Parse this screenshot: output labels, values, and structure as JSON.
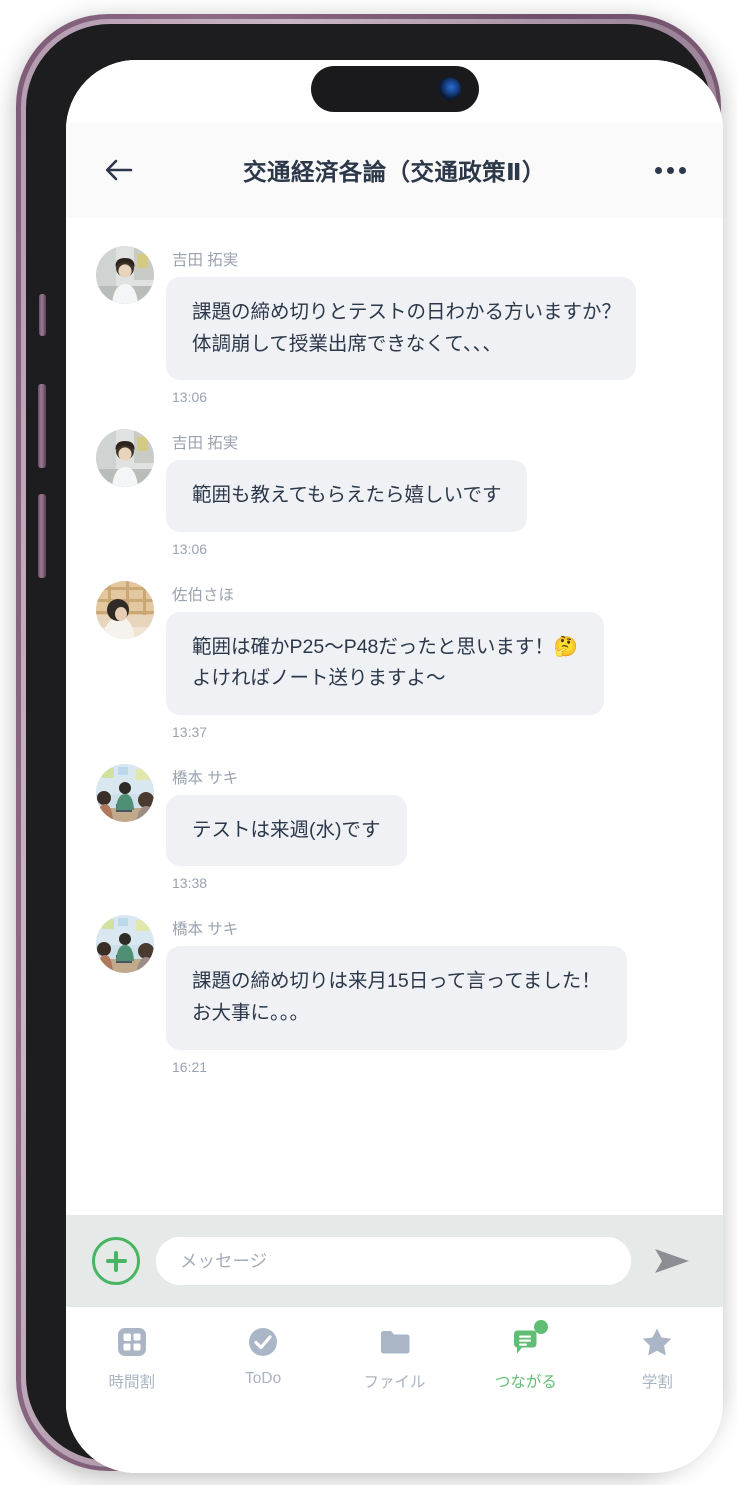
{
  "device": {
    "frame_color": "#7e5c78",
    "bezel_color": "#1d1d1f",
    "island_label": "dynamic-island"
  },
  "appbar": {
    "title": "交通経済各論（交通政策Ⅱ）",
    "back_icon": "arrow-left-icon",
    "more_icon": "more-options-icon",
    "background": "#fafafa",
    "text_color": "#2c3849"
  },
  "chat": {
    "bubble_color": "#eff1f5",
    "text_color": "#2c3849",
    "meta_color": "#9aa3af",
    "messages": [
      {
        "sender": "吉田 拓実",
        "avatar": "avatar-yoshida",
        "lines": [
          "課題の締め切りとテストの日わかる方いますか？",
          "体調崩して授業出席できなくて、、、"
        ],
        "time": "13:06"
      },
      {
        "sender": "吉田 拓実",
        "avatar": "avatar-yoshida",
        "lines": [
          "範囲も教えてもらえたら嬉しいです"
        ],
        "time": "13:06"
      },
      {
        "sender": "佐伯さほ",
        "avatar": "avatar-saeki",
        "lines": [
          "範囲は確かP25〜P48だったと思います！🤔",
          "よければノート送りますよ〜"
        ],
        "time": "13:37"
      },
      {
        "sender": "橋本 サキ",
        "avatar": "avatar-hashimoto",
        "lines": [
          "テストは来週(水)です"
        ],
        "time": "13:38"
      },
      {
        "sender": "橋本 サキ",
        "avatar": "avatar-hashimoto",
        "lines": [
          "課題の締め切りは来月15日って言ってました！",
          "お大事に。。。"
        ],
        "time": "16:21"
      }
    ]
  },
  "composer": {
    "add_icon": "plus-circle-icon",
    "placeholder": "メッセージ",
    "value": "",
    "send_icon": "send-arrow-icon",
    "background": "#e5eae9",
    "accent": "#49b563"
  },
  "bottomnav": {
    "active_color": "#5fbe73",
    "inactive_color": "#a9b4c4",
    "items": [
      {
        "label": "時間割",
        "icon": "grid-icon",
        "active": false,
        "badge": false
      },
      {
        "label": "ToDo",
        "icon": "check-circle-icon",
        "active": false,
        "badge": false
      },
      {
        "label": "ファイル",
        "icon": "folder-icon",
        "active": false,
        "badge": false
      },
      {
        "label": "つながる",
        "icon": "chat-bubble-icon",
        "active": true,
        "badge": true
      },
      {
        "label": "学割",
        "icon": "star-icon",
        "active": false,
        "badge": false
      }
    ]
  }
}
